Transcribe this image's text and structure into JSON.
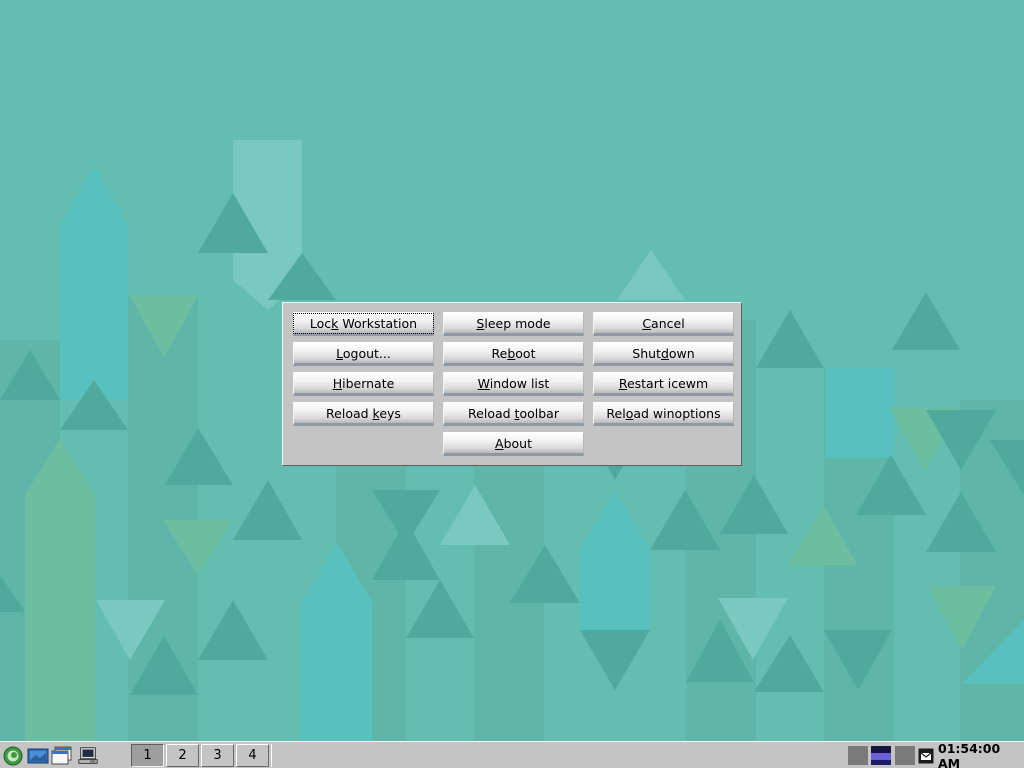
{
  "dialog": {
    "buttons": {
      "lock": {
        "label": "Lock Workstation",
        "mnemonic": "k"
      },
      "sleep": {
        "label": "Sleep mode",
        "mnemonic": "S"
      },
      "cancel": {
        "label": "Cancel",
        "mnemonic": "C"
      },
      "logout": {
        "label": "Logout...",
        "mnemonic": "L"
      },
      "reboot": {
        "label": "Reboot",
        "mnemonic": "b"
      },
      "shutdown": {
        "label": "Shutdown",
        "mnemonic": "d"
      },
      "hibernate": {
        "label": "Hibernate",
        "mnemonic": "H"
      },
      "window_list": {
        "label": "Window list",
        "mnemonic": "W"
      },
      "restart": {
        "label": "Restart icewm",
        "mnemonic": "R"
      },
      "reload_keys": {
        "label": "Reload keys",
        "mnemonic": "k"
      },
      "reload_toolbar": {
        "label": "Reload toolbar",
        "mnemonic": "t"
      },
      "reload_winoptions": {
        "label": "Reload winoptions",
        "mnemonic": "o"
      },
      "about": {
        "label": "About",
        "mnemonic": "A"
      }
    }
  },
  "taskbar": {
    "workspaces": [
      "1",
      "2",
      "3",
      "4"
    ],
    "active_workspace": "1",
    "quick_launch_icons": [
      "start-menu-icon",
      "file-manager-icon",
      "window-list-icon",
      "terminal-icon"
    ],
    "tray_icons": [
      "cpu-monitor-icon",
      "network-monitor-icon",
      "volume-icon",
      "mail-icon"
    ],
    "clock": "01:54:00 AM"
  },
  "colors": {
    "wallpaper": "#64bdb1",
    "dialog_bg": "#c4c4c4",
    "taskbar_bg": "#c4c4c4",
    "button_underline": "#8d99a6"
  }
}
